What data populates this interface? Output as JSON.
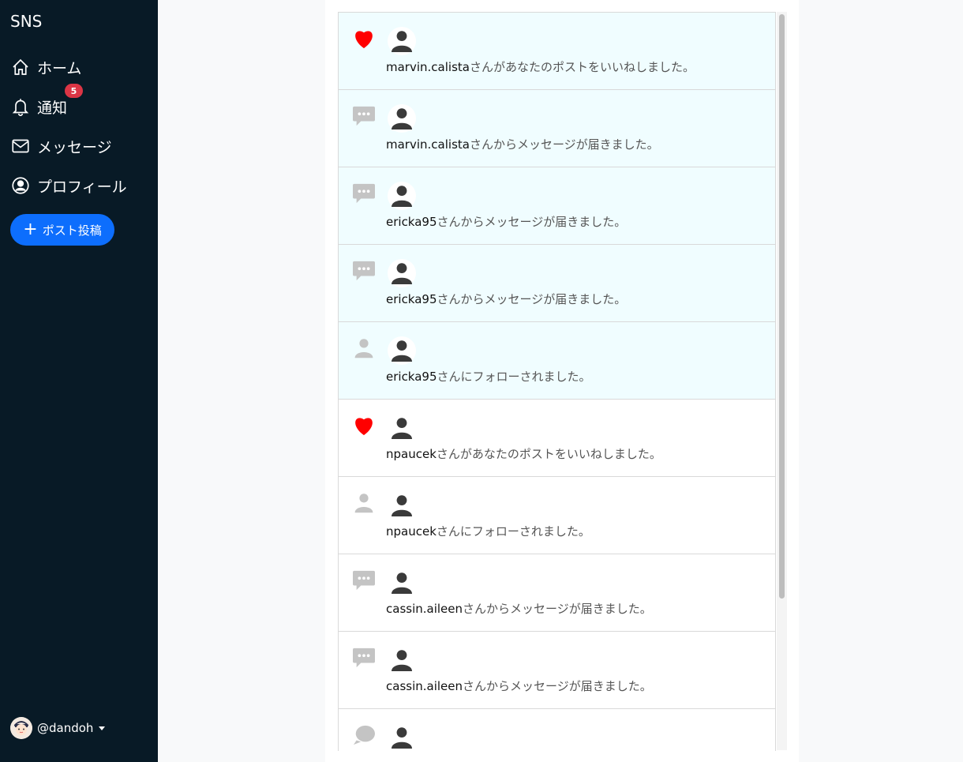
{
  "sidebar": {
    "brand": "SNS",
    "nav": [
      {
        "label": "ホーム",
        "icon": "house-icon"
      },
      {
        "label": "通知",
        "icon": "bell-icon"
      },
      {
        "label": "メッセージ",
        "icon": "envelope-icon"
      },
      {
        "label": "プロフィール",
        "icon": "person-circle-icon"
      }
    ],
    "notification_badge": "5",
    "post_button_label": "ポスト投稿",
    "user": {
      "handle": "@dandoh"
    }
  },
  "notifications": [
    {
      "type": "like",
      "icon": "heart-icon",
      "user": "marvin.calista",
      "message": "さんがあなたのポストをいいねしました。",
      "unread": true
    },
    {
      "type": "message",
      "icon": "chat-dots-icon",
      "user": "marvin.calista",
      "message": "さんからメッセージが届きました。",
      "unread": true
    },
    {
      "type": "message",
      "icon": "chat-dots-icon",
      "user": "ericka95",
      "message": "さんからメッセージが届きました。",
      "unread": true
    },
    {
      "type": "message",
      "icon": "chat-dots-icon",
      "user": "ericka95",
      "message": "さんからメッセージが届きました。",
      "unread": true
    },
    {
      "type": "follow",
      "icon": "person-icon",
      "user": "ericka95",
      "message": "さんにフォローされました。",
      "unread": true
    },
    {
      "type": "like",
      "icon": "heart-icon",
      "user": "npaucek",
      "message": "さんがあなたのポストをいいねしました。",
      "unread": false
    },
    {
      "type": "follow",
      "icon": "person-icon",
      "user": "npaucek",
      "message": "さんにフォローされました。",
      "unread": false
    },
    {
      "type": "message",
      "icon": "chat-dots-icon",
      "user": "cassin.aileen",
      "message": "さんからメッセージが届きました。",
      "unread": false
    },
    {
      "type": "message",
      "icon": "chat-dots-icon",
      "user": "cassin.aileen",
      "message": "さんからメッセージが届きました。",
      "unread": false
    },
    {
      "type": "reply",
      "icon": "chat-icon",
      "user": "",
      "message": "",
      "unread": false
    }
  ],
  "colors": {
    "sidebar_bg": "#081a26",
    "accent": "#0d6efd",
    "badge": "#dc3545",
    "like": "#ff0000",
    "unread_bg": "#f0fdff"
  }
}
